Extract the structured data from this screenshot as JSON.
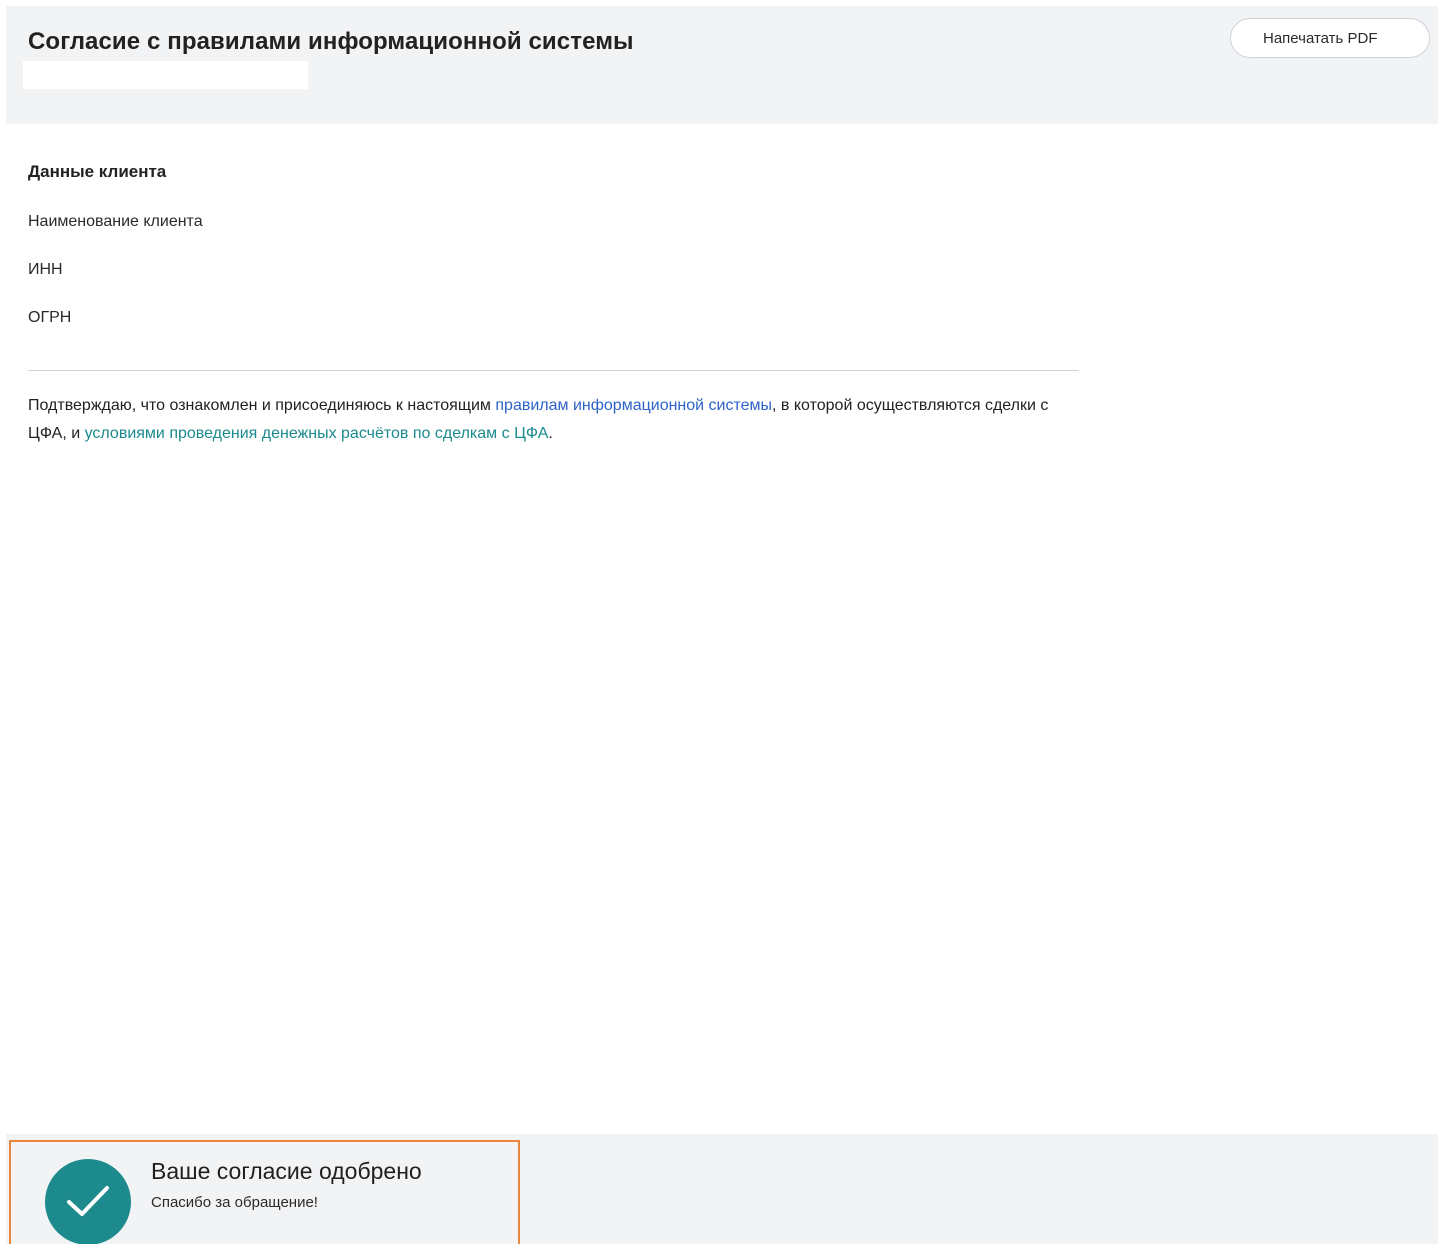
{
  "header": {
    "title": "Согласие с правилами информационной системы",
    "print_button_label": "Напечатать PDF"
  },
  "client_data": {
    "section_title": "Данные клиента",
    "fields": [
      {
        "label": "Наименование клиента"
      },
      {
        "label": "ИНН"
      },
      {
        "label": "ОГРН"
      }
    ]
  },
  "consent": {
    "text_before": "Подтверждаю, что ознакомлен и присоединяюсь к настоящим ",
    "link_rules": "правилам информационной системы",
    "text_middle": ", в которой осуществляются сделки с ЦФА, и ",
    "link_conditions": "условиями проведения денежных расчётов по сделкам с ЦФА",
    "text_after": "."
  },
  "notification": {
    "title": "Ваше согласие одобрено",
    "subtitle": "Спасибо за обращение!",
    "icon": "checkmark-icon"
  },
  "colors": {
    "header_bg": "#f2f3f5",
    "link_blue": "#2d63c8",
    "link_teal": "#1a8a8e",
    "success_circle": "#1d8a8d",
    "highlight_border": "#e8863c"
  }
}
